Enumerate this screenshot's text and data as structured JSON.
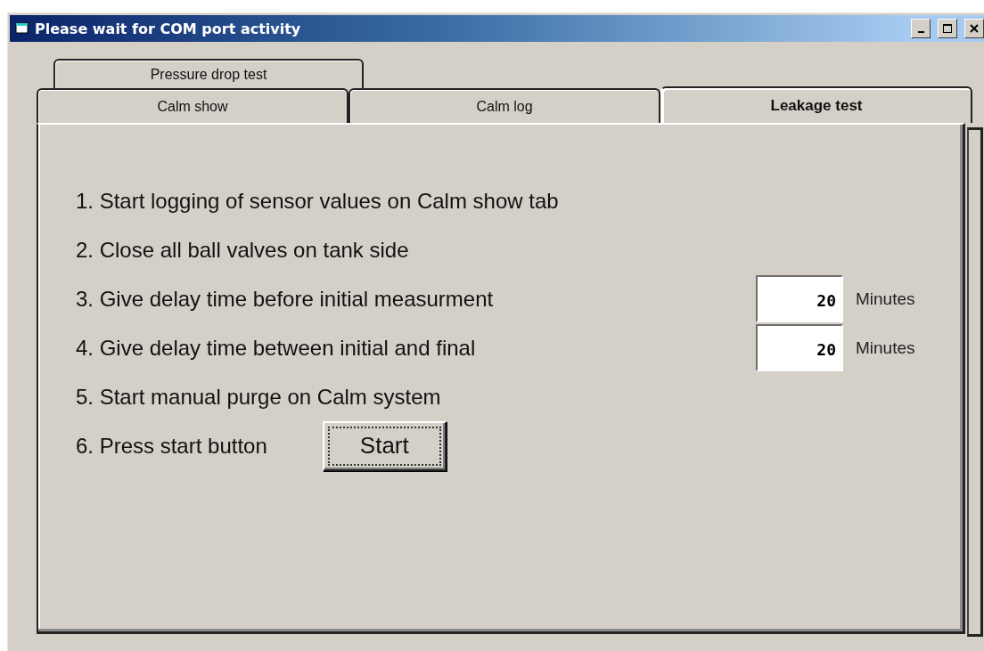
{
  "window": {
    "title": "Please wait for COM port activity"
  },
  "tab_rows": [
    [
      {
        "label": "Pressure drop test",
        "selected": false
      }
    ],
    [
      {
        "label": "Calm show",
        "selected": false
      },
      {
        "label": "Calm log",
        "selected": false
      },
      {
        "label": "Leakage test",
        "selected": true
      }
    ]
  ],
  "steps": [
    {
      "kind": "text",
      "label": "1. Start logging of sensor values on Calm show tab"
    },
    {
      "kind": "text",
      "label": "2. Close all ball valves on tank side"
    },
    {
      "kind": "delay",
      "label": "3. Give delay time before initial measurment",
      "value": "20",
      "unit": "Minutes"
    },
    {
      "kind": "delay",
      "label": "4. Give delay time between initial and final",
      "value": "20",
      "unit": "Minutes"
    },
    {
      "kind": "text",
      "label": "5. Start manual purge on Calm system"
    },
    {
      "kind": "button",
      "label": "6. Press start button",
      "button": "Start"
    }
  ]
}
